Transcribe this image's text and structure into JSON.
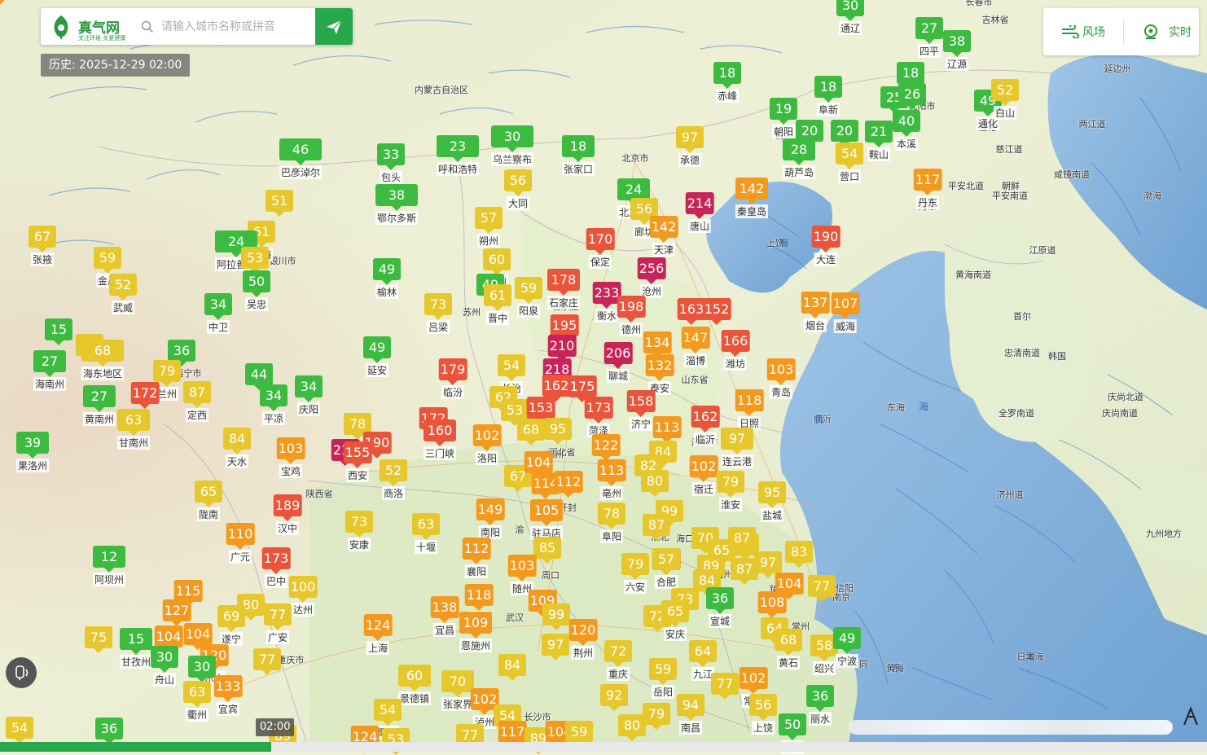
{
  "search": {
    "logo_name": "真气网",
    "logo_slogan": "关注环境 关爱健康",
    "placeholder": "请输入城市名称或拼音"
  },
  "history": {
    "label": "历史: 2025-12-29 02:00"
  },
  "right_panel": {
    "wind_label": "风场",
    "realtime_label": "实时"
  },
  "timeline": {
    "current_time": "02:00",
    "progress": 0.225
  },
  "aqi_colors": {
    "good": "#3dbb41",
    "moderate": "#e6c72c",
    "sensitive": "#f39a1e",
    "unhealthy": "#e9543a",
    "very_unhealthy": "#c8245a"
  },
  "markers": [
    {
      "value": "30",
      "city": "通辽",
      "level": "good"
    },
    {
      "value": "27",
      "city": "四平",
      "level": "good"
    },
    {
      "value": "38",
      "city": "辽源",
      "level": "good"
    },
    {
      "value": "18",
      "city": "赤峰",
      "level": "good"
    },
    {
      "value": "18",
      "city": "阜新",
      "level": "good"
    },
    {
      "value": "18",
      "city": "",
      "level": "good"
    },
    {
      "value": "25",
      "city": "",
      "level": "good"
    },
    {
      "value": "26",
      "city": "",
      "level": "good"
    },
    {
      "value": "49",
      "city": "通化",
      "level": "good"
    },
    {
      "value": "52",
      "city": "白山",
      "level": "moderate"
    },
    {
      "value": "19",
      "city": "朝阳",
      "level": "good"
    },
    {
      "value": "20",
      "city": "",
      "level": "good"
    },
    {
      "value": "20",
      "city": "",
      "level": "good"
    },
    {
      "value": "21",
      "city": "鞍山",
      "level": "good"
    },
    {
      "value": "40",
      "city": "本溪",
      "level": "good"
    },
    {
      "value": "28",
      "city": "葫芦岛",
      "level": "good"
    },
    {
      "value": "54",
      "city": "营口",
      "level": "moderate"
    },
    {
      "value": "97",
      "city": "承德",
      "level": "moderate"
    },
    {
      "value": "46",
      "city": "巴彦淖尔",
      "level": "good"
    },
    {
      "value": "33",
      "city": "包头",
      "level": "good"
    },
    {
      "value": "23",
      "city": "呼和浩特",
      "level": "good"
    },
    {
      "value": "30",
      "city": "乌兰察布",
      "level": "good"
    },
    {
      "value": "18",
      "city": "张家口",
      "level": "good"
    },
    {
      "value": "117",
      "city": "丹东",
      "level": "sensitive"
    },
    {
      "value": "142",
      "city": "秦皇岛",
      "level": "sensitive"
    },
    {
      "value": "214",
      "city": "唐山",
      "level": "very_unhealthy"
    },
    {
      "value": "24",
      "city": "北京市",
      "level": "good"
    },
    {
      "value": "56",
      "city": "廊坊",
      "level": "moderate"
    },
    {
      "value": "142",
      "city": "天津",
      "level": "sensitive"
    },
    {
      "value": "56",
      "city": "大同",
      "level": "moderate"
    },
    {
      "value": "38",
      "city": "鄂尔多斯",
      "level": "good"
    },
    {
      "value": "51",
      "city": "",
      "level": "moderate"
    },
    {
      "value": "61",
      "city": "乌海",
      "level": "moderate"
    },
    {
      "value": "57",
      "city": "朔州",
      "level": "moderate"
    },
    {
      "value": "190",
      "city": "大连",
      "level": "unhealthy"
    },
    {
      "value": "67",
      "city": "张掖",
      "level": "moderate"
    },
    {
      "value": "59",
      "city": "金昌",
      "level": "moderate"
    },
    {
      "value": "24",
      "city": "阿拉善盟",
      "level": "good"
    },
    {
      "value": "53",
      "city": "",
      "level": "moderate"
    },
    {
      "value": "52",
      "city": "武威",
      "level": "moderate"
    },
    {
      "value": "50",
      "city": "吴忠",
      "level": "good"
    },
    {
      "value": "60",
      "city": "忻州",
      "level": "moderate"
    },
    {
      "value": "170",
      "city": "保定",
      "level": "unhealthy"
    },
    {
      "value": "256",
      "city": "沧州",
      "level": "very_unhealthy"
    },
    {
      "value": "49",
      "city": "榆林",
      "level": "good"
    },
    {
      "value": "49",
      "city": "",
      "level": "good"
    },
    {
      "value": "59",
      "city": "阳泉",
      "level": "moderate"
    },
    {
      "value": "178",
      "city": "石家庄",
      "level": "unhealthy"
    },
    {
      "value": "233",
      "city": "衡水",
      "level": "very_unhealthy"
    },
    {
      "value": "198",
      "city": "德州",
      "level": "unhealthy"
    },
    {
      "value": "61",
      "city": "晋中",
      "level": "moderate"
    },
    {
      "value": "34",
      "city": "中卫",
      "level": "good"
    },
    {
      "value": "15",
      "city": "",
      "level": "good"
    },
    {
      "value": "73",
      "city": "吕梁",
      "level": "moderate"
    },
    {
      "value": "163",
      "city": "",
      "level": "unhealthy"
    },
    {
      "value": "152",
      "city": "",
      "level": "unhealthy"
    },
    {
      "value": "137",
      "city": "烟台",
      "level": "sensitive"
    },
    {
      "value": "107",
      "city": "威海",
      "level": "sensitive"
    },
    {
      "value": "54",
      "city": "",
      "level": "moderate"
    },
    {
      "value": "68",
      "city": "海东地区",
      "level": "moderate"
    },
    {
      "value": "195",
      "city": "",
      "level": "unhealthy"
    },
    {
      "value": "134",
      "city": "",
      "level": "sensitive"
    },
    {
      "value": "147",
      "city": "淄博",
      "level": "sensitive"
    },
    {
      "value": "166",
      "city": "潍坊",
      "level": "unhealthy"
    },
    {
      "value": "27",
      "city": "海南州",
      "level": "good"
    },
    {
      "value": "36",
      "city": "",
      "level": "good"
    },
    {
      "value": "49",
      "city": "延安",
      "level": "good"
    },
    {
      "value": "210",
      "city": "",
      "level": "very_unhealthy"
    },
    {
      "value": "206",
      "city": "聊城",
      "level": "very_unhealthy"
    },
    {
      "value": "132",
      "city": "泰安",
      "level": "sensitive"
    },
    {
      "value": "79",
      "city": "兰州",
      "level": "moderate"
    },
    {
      "value": "44",
      "city": "",
      "level": "good"
    },
    {
      "value": "54",
      "city": "长治",
      "level": "moderate"
    },
    {
      "value": "179",
      "city": "临汾",
      "level": "unhealthy"
    },
    {
      "value": "218",
      "city": "",
      "level": "very_unhealthy"
    },
    {
      "value": "103",
      "city": "青岛",
      "level": "sensitive"
    },
    {
      "value": "34",
      "city": "庆阳",
      "level": "good"
    },
    {
      "value": "172",
      "city": "",
      "level": "unhealthy"
    },
    {
      "value": "87",
      "city": "定西",
      "level": "moderate"
    },
    {
      "value": "34",
      "city": "平凉",
      "level": "good"
    },
    {
      "value": "162",
      "city": "",
      "level": "unhealthy"
    },
    {
      "value": "175",
      "city": "",
      "level": "unhealthy"
    },
    {
      "value": "62",
      "city": "",
      "level": "moderate"
    },
    {
      "value": "27",
      "city": "黄南州",
      "level": "good"
    },
    {
      "value": "53",
      "city": "",
      "level": "moderate"
    },
    {
      "value": "153",
      "city": "",
      "level": "unhealthy"
    },
    {
      "value": "173",
      "city": "菏泽",
      "level": "unhealthy"
    },
    {
      "value": "158",
      "city": "济宁",
      "level": "unhealthy"
    },
    {
      "value": "118",
      "city": "日照",
      "level": "sensitive"
    },
    {
      "value": "63",
      "city": "甘南州",
      "level": "moderate"
    },
    {
      "value": "78",
      "city": "",
      "level": "moderate"
    },
    {
      "value": "172",
      "city": "",
      "level": "unhealthy"
    },
    {
      "value": "68",
      "city": "",
      "level": "moderate"
    },
    {
      "value": "95",
      "city": "",
      "level": "moderate"
    },
    {
      "value": "162",
      "city": "临沂",
      "level": "unhealthy"
    },
    {
      "value": "113",
      "city": "",
      "level": "sensitive"
    },
    {
      "value": "39",
      "city": "果洛州",
      "level": "good"
    },
    {
      "value": "84",
      "city": "天水",
      "level": "moderate"
    },
    {
      "value": "103",
      "city": "宝鸡",
      "level": "sensitive"
    },
    {
      "value": "160",
      "city": "三门峡",
      "level": "unhealthy"
    },
    {
      "value": "102",
      "city": "洛阳",
      "level": "sensitive"
    },
    {
      "value": "97",
      "city": "连云港",
      "level": "moderate"
    },
    {
      "value": "214",
      "city": "",
      "level": "very_unhealthy"
    },
    {
      "value": "190",
      "city": "",
      "level": "unhealthy"
    },
    {
      "value": "122",
      "city": "",
      "level": "sensitive"
    },
    {
      "value": "84",
      "city": "",
      "level": "moderate"
    },
    {
      "value": "155",
      "city": "西安",
      "level": "unhealthy"
    },
    {
      "value": "52",
      "city": "商洛",
      "level": "moderate"
    },
    {
      "value": "67",
      "city": "",
      "level": "moderate"
    },
    {
      "value": "104",
      "city": "",
      "level": "sensitive"
    },
    {
      "value": "113",
      "city": "亳州",
      "level": "sensitive"
    },
    {
      "value": "82",
      "city": "",
      "level": "moderate"
    },
    {
      "value": "102",
      "city": "宿迁",
      "level": "sensitive"
    },
    {
      "value": "65",
      "city": "陇南",
      "level": "moderate"
    },
    {
      "value": "114",
      "city": "",
      "level": "sensitive"
    },
    {
      "value": "112",
      "city": "",
      "level": "sensitive"
    },
    {
      "value": "80",
      "city": "",
      "level": "moderate"
    },
    {
      "value": "79",
      "city": "淮安",
      "level": "moderate"
    },
    {
      "value": "95",
      "city": "盐城",
      "level": "moderate"
    },
    {
      "value": "189",
      "city": "汉中",
      "level": "unhealthy"
    },
    {
      "value": "73",
      "city": "安康",
      "level": "moderate"
    },
    {
      "value": "149",
      "city": "南阳",
      "level": "sensitive"
    },
    {
      "value": "105",
      "city": "驻马店",
      "level": "sensitive"
    },
    {
      "value": "78",
      "city": "阜阳",
      "level": "moderate"
    },
    {
      "value": "99",
      "city": "",
      "level": "moderate"
    },
    {
      "value": "63",
      "city": "十堰",
      "level": "moderate"
    },
    {
      "value": "87",
      "city": "",
      "level": "moderate"
    },
    {
      "value": "110",
      "city": "广元",
      "level": "sensitive"
    },
    {
      "value": "12",
      "city": "阿坝州",
      "level": "good"
    },
    {
      "value": "173",
      "city": "巴中",
      "level": "unhealthy"
    },
    {
      "value": "112",
      "city": "襄阳",
      "level": "sensitive"
    },
    {
      "value": "85",
      "city": "",
      "level": "moderate"
    },
    {
      "value": "70",
      "city": "",
      "level": "moderate"
    },
    {
      "value": "83",
      "city": "",
      "level": "moderate"
    },
    {
      "value": "65",
      "city": "",
      "level": "moderate"
    },
    {
      "value": "87",
      "city": "",
      "level": "moderate"
    },
    {
      "value": "83",
      "city": "",
      "level": "moderate"
    },
    {
      "value": "113",
      "city": "",
      "level": "sensitive"
    },
    {
      "value": "103",
      "city": "随州",
      "level": "sensitive"
    },
    {
      "value": "79",
      "city": "六安",
      "level": "moderate"
    },
    {
      "value": "57",
      "city": "合肥",
      "level": "moderate"
    },
    {
      "value": "89",
      "city": "",
      "level": "moderate"
    },
    {
      "value": "97",
      "city": "",
      "level": "moderate"
    },
    {
      "value": "87",
      "city": "",
      "level": "moderate"
    },
    {
      "value": "115",
      "city": "",
      "level": "sensitive"
    },
    {
      "value": "100",
      "city": "达州",
      "level": "moderate"
    },
    {
      "value": "118",
      "city": "孝感",
      "level": "sensitive"
    },
    {
      "value": "84",
      "city": "",
      "level": "moderate"
    },
    {
      "value": "104",
      "city": "",
      "level": "sensitive"
    },
    {
      "value": "77",
      "city": "",
      "level": "moderate"
    },
    {
      "value": "127",
      "city": "",
      "level": "sensitive"
    },
    {
      "value": "80",
      "city": "",
      "level": "moderate"
    },
    {
      "value": "69",
      "city": "遂宁",
      "level": "moderate"
    },
    {
      "value": "77",
      "city": "广安",
      "level": "moderate"
    },
    {
      "value": "138",
      "city": "宜昌",
      "level": "sensitive"
    },
    {
      "value": "109",
      "city": "",
      "level": "sensitive"
    },
    {
      "value": "99",
      "city": "",
      "level": "moderate"
    },
    {
      "value": "73",
      "city": "",
      "level": "moderate"
    },
    {
      "value": "36",
      "city": "宣城",
      "level": "good"
    },
    {
      "value": "108",
      "city": "",
      "level": "sensitive"
    },
    {
      "value": "124",
      "city": "上海",
      "level": "sensitive"
    },
    {
      "value": "109",
      "city": "恩施州",
      "level": "sensitive"
    },
    {
      "value": "120",
      "city": "荆州",
      "level": "sensitive"
    },
    {
      "value": "72",
      "city": "",
      "level": "moderate"
    },
    {
      "value": "65",
      "city": "安庆",
      "level": "moderate"
    },
    {
      "value": "64",
      "city": "",
      "level": "moderate"
    },
    {
      "value": "75",
      "city": "",
      "level": "moderate"
    },
    {
      "value": "15",
      "city": "甘孜州",
      "level": "good"
    },
    {
      "value": "104",
      "city": "雅安",
      "level": "sensitive"
    },
    {
      "value": "104",
      "city": "",
      "level": "sensitive"
    },
    {
      "value": "97",
      "city": "",
      "level": "moderate"
    },
    {
      "value": "68",
      "city": "黄石",
      "level": "moderate"
    },
    {
      "value": "58",
      "city": "绍兴",
      "level": "moderate"
    },
    {
      "value": "49",
      "city": "宁波",
      "level": "good"
    },
    {
      "value": "30",
      "city": "舟山",
      "level": "good"
    },
    {
      "value": "120",
      "city": "乐山",
      "level": "sensitive"
    },
    {
      "value": "77",
      "city": "",
      "level": "moderate"
    },
    {
      "value": "72",
      "city": "重庆",
      "level": "moderate"
    },
    {
      "value": "64",
      "city": "九江",
      "level": "moderate"
    },
    {
      "value": "30",
      "city": "黄山",
      "level": "good"
    },
    {
      "value": "84",
      "city": "",
      "level": "moderate"
    },
    {
      "value": "59",
      "city": "岳阳",
      "level": "moderate"
    },
    {
      "value": "60",
      "city": "景德镇",
      "level": "moderate"
    },
    {
      "value": "70",
      "city": "张家界",
      "level": "moderate"
    },
    {
      "value": "102",
      "city": "常德",
      "level": "sensitive"
    },
    {
      "value": "77",
      "city": "",
      "level": "moderate"
    },
    {
      "value": "63",
      "city": "衢州",
      "level": "moderate"
    },
    {
      "value": "133",
      "city": "宜宾",
      "level": "sensitive"
    },
    {
      "value": "102",
      "city": "泸州",
      "level": "sensitive"
    },
    {
      "value": "92",
      "city": "",
      "level": "moderate"
    },
    {
      "value": "94",
      "city": "南昌",
      "level": "moderate"
    },
    {
      "value": "56",
      "city": "上饶",
      "level": "moderate"
    },
    {
      "value": "36",
      "city": "丽水",
      "level": "good"
    },
    {
      "value": "50",
      "city": "台州",
      "level": "good"
    },
    {
      "value": "54",
      "city": "",
      "level": "moderate"
    },
    {
      "value": "80",
      "city": "",
      "level": "moderate"
    },
    {
      "value": "79",
      "city": "",
      "level": "moderate"
    },
    {
      "value": "54",
      "city": "鹰潭",
      "level": "moderate"
    },
    {
      "value": "54",
      "city": "",
      "level": "moderate"
    },
    {
      "value": "36",
      "city": "",
      "level": "good"
    },
    {
      "value": "124",
      "city": "",
      "level": "sensitive"
    },
    {
      "value": "53",
      "city": "",
      "level": "moderate"
    },
    {
      "value": "77",
      "city": "",
      "level": "moderate"
    },
    {
      "value": "117",
      "city": "",
      "level": "sensitive"
    },
    {
      "value": "89",
      "city": "",
      "level": "moderate"
    },
    {
      "value": "104",
      "city": "",
      "level": "sensitive"
    },
    {
      "value": "59",
      "city": "",
      "level": "moderate"
    },
    {
      "value": "89",
      "city": "",
      "level": "moderate"
    },
    {
      "value": "105",
      "city": "",
      "level": "sensitive"
    }
  ],
  "map_labels": [
    "长春市",
    "吉林省",
    "延边州",
    "内蒙古自治区",
    "北京市",
    "朝阳",
    "沈阳市",
    "丹东",
    "通化",
    "两江道",
    "慈江道",
    "咸镜南道",
    "朝鲜",
    "平安北道",
    "平安南道",
    "江原道",
    "黄海南道",
    "首尔",
    "忠清南道",
    "韩国",
    "庆尚北道",
    "全罗南道",
    "庆尚南道",
    "济州道",
    "九州地方",
    "陕西省",
    "河北省",
    "山东省",
    "石家庄",
    "银川市",
    "西宁市",
    "重庆市",
    "长沙市",
    "武汉",
    "渝",
    "郑州",
    "开封",
    "周口",
    "信阳",
    "海口",
    "淮北",
    "蚌埠",
    "镇江",
    "常州",
    "杭州",
    "南京",
    "苏州",
    "海盐市",
    "山西大同",
    "临沂",
    "上饶",
    "黄海",
    "渤海",
    "东海",
    "日本海"
  ],
  "sea_labels": [
    "黄",
    "海",
    "海",
    "东",
    "海"
  ],
  "icons": {
    "logo": "zhenqi-logo-icon",
    "search": "search-icon",
    "go": "send-icon",
    "wind": "wind-icon",
    "realtime": "location-pin-icon",
    "voice": "voice-assist-icon",
    "corner": "flag-icon"
  }
}
